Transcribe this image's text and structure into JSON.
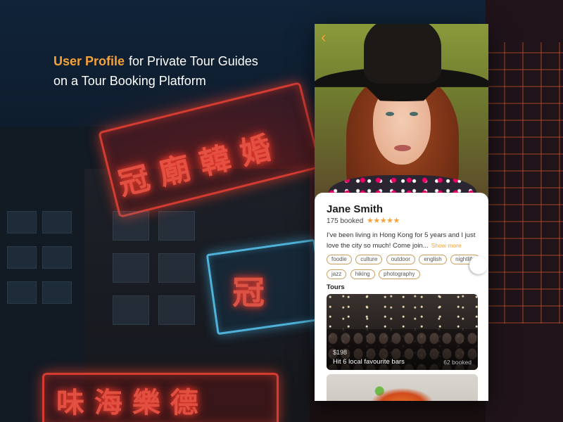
{
  "headline": {
    "accent": "User Profile",
    "line1": "for Private Tour Guides",
    "line2": "on a Tour Booking Platform"
  },
  "colors": {
    "accent": "#f5a23a"
  },
  "profile": {
    "back_icon": "chevron-left-icon",
    "name": "Jane Smith",
    "booked": "175 booked",
    "rating_stars": 5,
    "bio": "I've been living in Hong Kong for 5 years and I just love the city so much! Come join...",
    "show_more": "Show more",
    "tags": [
      "foodie",
      "culture",
      "outdoor",
      "english",
      "nightlife",
      "jazz",
      "hiking",
      "photography"
    ]
  },
  "tours": {
    "label": "Tours",
    "items": [
      {
        "price": "$198",
        "title": "Hit 6 local favourite bars",
        "booked": "62 booked"
      }
    ]
  }
}
